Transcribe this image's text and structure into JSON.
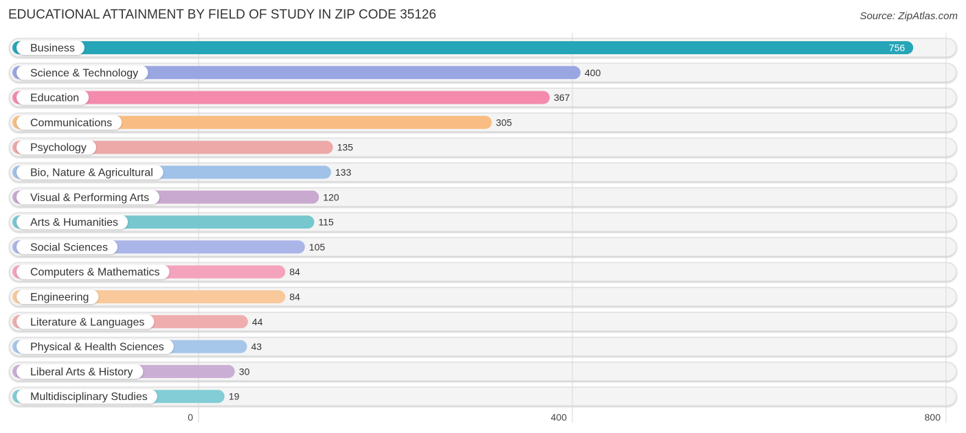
{
  "chart_data": {
    "type": "bar",
    "orientation": "horizontal",
    "title": "EDUCATIONAL ATTAINMENT BY FIELD OF STUDY IN ZIP CODE 35126",
    "source": "Source: ZipAtlas.com",
    "xlabel": "",
    "ylabel": "",
    "xlim": [
      0,
      800
    ],
    "xticks": [
      0,
      400,
      800
    ],
    "xtick_labels": [
      "0",
      "400",
      "800"
    ],
    "grid": true,
    "categories": [
      "Business",
      "Science & Technology",
      "Education",
      "Communications",
      "Psychology",
      "Bio, Nature & Agricultural",
      "Visual & Performing Arts",
      "Arts & Humanities",
      "Social Sciences",
      "Computers & Mathematics",
      "Engineering",
      "Literature & Languages",
      "Physical & Health Sciences",
      "Liberal Arts & History",
      "Multidisciplinary Studies"
    ],
    "values": [
      756,
      400,
      367,
      305,
      135,
      133,
      120,
      115,
      105,
      84,
      84,
      44,
      43,
      30,
      19
    ],
    "colors": [
      "#26a5b8",
      "#99a6e2",
      "#f48aac",
      "#f9bd84",
      "#eda8a8",
      "#a0c2e8",
      "#c9a9cf",
      "#77c7cf",
      "#aab5e8",
      "#f5a3bd",
      "#f9c99c",
      "#f0adad",
      "#a6c6ea",
      "#caaed4",
      "#82cdd6"
    ]
  }
}
